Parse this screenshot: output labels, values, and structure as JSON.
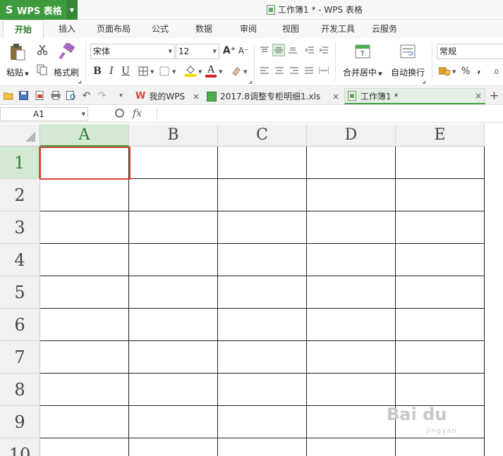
{
  "app": {
    "logo": "S",
    "name": "WPS 表格",
    "window_title": "工作簿1 * - WPS 表格"
  },
  "menu_tabs": [
    "开始",
    "插入",
    "页面布局",
    "公式",
    "数据",
    "审阅",
    "视图",
    "开发工具",
    "云服务"
  ],
  "active_tab": "开始",
  "ribbon": {
    "paste": "粘贴",
    "format_painter": "格式刷",
    "font_name": "宋体",
    "font_size": "12",
    "font_grow": "A⁺",
    "font_shrink": "A⁻",
    "bold": "B",
    "italic": "I",
    "underline": "U",
    "font_color_glyph": "A",
    "merge_center": "合并居中",
    "wrap_text": "自动换行",
    "number_format": "常规",
    "percent": "%",
    "comma": ",",
    "colors": {
      "fill": "#f5d800",
      "font": "#e02020",
      "accent": "#3d9a3d"
    }
  },
  "doc_tabs": [
    {
      "title": "我的WPS",
      "active": false
    },
    {
      "title": "2017.8调整专柜明细1.xls",
      "active": false
    },
    {
      "title": "工作簿1 *",
      "active": true
    }
  ],
  "formula_bar": {
    "name_box": "A1",
    "fx": "fx",
    "value": ""
  },
  "sheet": {
    "columns": [
      "A",
      "B",
      "C",
      "D",
      "E"
    ],
    "rows": [
      "1",
      "2",
      "3",
      "4",
      "5",
      "6",
      "7",
      "8",
      "9",
      "10"
    ],
    "active_cell": "A1"
  },
  "watermark": {
    "logo": "Bai du",
    "sub": "jingyan"
  }
}
